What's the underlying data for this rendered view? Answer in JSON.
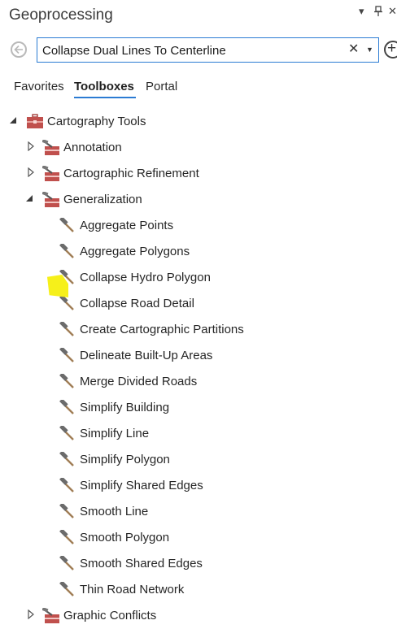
{
  "panel": {
    "title": "Geoprocessing",
    "controls": [
      "▾",
      "⊥",
      "✕"
    ]
  },
  "search": {
    "value": "Collapse Dual Lines To Centerline",
    "clear_icon": "close-icon",
    "dropdown_icon": "chevron-down-icon"
  },
  "tabs": [
    {
      "label": "Favorites",
      "active": false
    },
    {
      "label": "Toolboxes",
      "active": true
    },
    {
      "label": "Portal",
      "active": false
    }
  ],
  "tree": {
    "root": {
      "label": "Cartography Tools",
      "expanded": true,
      "icon": "toolbox-icon"
    },
    "toolsets": [
      {
        "label": "Annotation",
        "expanded": false,
        "icon": "toolset-icon"
      },
      {
        "label": "Cartographic Refinement",
        "expanded": false,
        "icon": "toolset-icon"
      },
      {
        "label": "Generalization",
        "expanded": true,
        "icon": "toolset-icon"
      }
    ],
    "generalization_tools": [
      "Aggregate Points",
      "Aggregate Polygons",
      "Collapse Hydro Polygon",
      "Collapse Road Detail",
      "Create Cartographic Partitions",
      "Delineate Built-Up Areas",
      "Merge Divided Roads",
      "Simplify Building",
      "Simplify Line",
      "Simplify Polygon",
      "Simplify Shared Edges",
      "Smooth Line",
      "Smooth Polygon",
      "Smooth Shared Edges",
      "Thin Road Network"
    ],
    "after": [
      {
        "label": "Graphic Conflicts",
        "expanded": false,
        "icon": "toolset-icon"
      }
    ]
  },
  "colors": {
    "accent": "#2b7bd3",
    "highlight": "#f6f01a",
    "toolbox": "#c0504d"
  }
}
